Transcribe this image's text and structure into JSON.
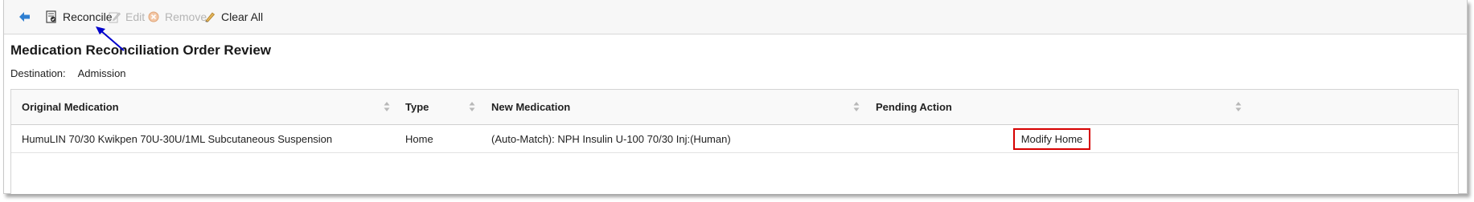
{
  "toolbar": {
    "back_icon": "back-arrow-icon",
    "reconcile": "Reconcile",
    "edit": "Edit",
    "remove": "Remove",
    "clear_all": "Clear All"
  },
  "page": {
    "title": "Medication Reconciliation Order Review",
    "destination_label": "Destination:",
    "destination_value": "Admission"
  },
  "table": {
    "headers": [
      "Original Medication",
      "Type",
      "New Medication",
      "Pending Action"
    ],
    "rows": [
      {
        "original": "HumuLIN 70/30 Kwikpen 70U-30U/1ML Subcutaneous Suspension",
        "type": "Home",
        "new": "(Auto-Match): NPH Insulin U-100 70/30 Inj:(Human)",
        "pending": "Modify Home"
      }
    ]
  },
  "colors": {
    "annotation_arrow": "#0000cc",
    "highlight_box": "#d60000",
    "back_arrow": "#2f7fd1"
  }
}
